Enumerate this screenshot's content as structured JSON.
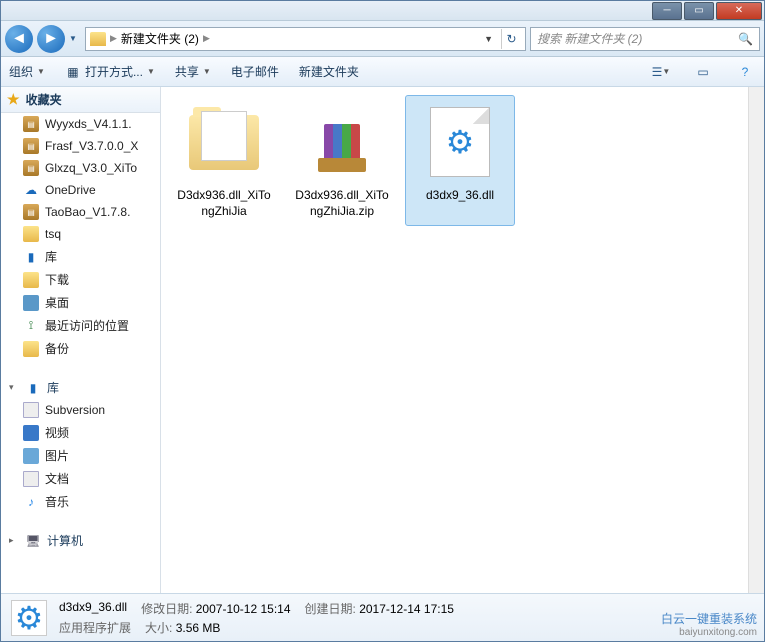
{
  "breadcrumb": {
    "current": "新建文件夹 (2)",
    "sep": "▶"
  },
  "search": {
    "placeholder": "搜索 新建文件夹 (2)"
  },
  "toolbar": {
    "organize": "组织",
    "open_with": "打开方式...",
    "share": "共享",
    "email": "电子邮件",
    "new_folder": "新建文件夹"
  },
  "sidebar": {
    "favorites": "收藏夹",
    "fav_items": [
      {
        "label": "Wyyxds_V4.1.1.",
        "icon": "rar"
      },
      {
        "label": "Frasf_V3.7.0.0_X",
        "icon": "rar"
      },
      {
        "label": "Glxzq_V3.0_XiTo",
        "icon": "rar"
      },
      {
        "label": "OneDrive",
        "icon": "cloud"
      },
      {
        "label": "TaoBao_V1.7.8.",
        "icon": "rar"
      },
      {
        "label": "tsq",
        "icon": "fold"
      },
      {
        "label": "库",
        "icon": "lib"
      },
      {
        "label": "下载",
        "icon": "fold"
      },
      {
        "label": "桌面",
        "icon": "desk"
      },
      {
        "label": "最近访问的位置",
        "icon": "loc"
      },
      {
        "label": "备份",
        "icon": "fold"
      }
    ],
    "library": "库",
    "lib_items": [
      {
        "label": "Subversion",
        "icon": "doc"
      },
      {
        "label": "视频",
        "icon": "vid"
      },
      {
        "label": "图片",
        "icon": "pic"
      },
      {
        "label": "文档",
        "icon": "doc"
      },
      {
        "label": "音乐",
        "icon": "mus"
      }
    ],
    "computer": "计算机"
  },
  "files": [
    {
      "label": "D3dx936.dll_XiTongZhiJia",
      "type": "folder"
    },
    {
      "label": "D3dx936.dll_XiTongZhiJia.zip",
      "type": "rar"
    },
    {
      "label": "d3dx9_36.dll",
      "type": "dll",
      "selected": true
    }
  ],
  "status": {
    "filename": "d3dx9_36.dll",
    "type": "应用程序扩展",
    "mod_label": "修改日期:",
    "mod_value": "2007-10-12 15:14",
    "create_label": "创建日期:",
    "create_value": "2017-12-14 17:15",
    "size_label": "大小:",
    "size_value": "3.56 MB"
  },
  "watermark": {
    "line1": "白云一键重装系统",
    "line2": "baiyunxitong.com"
  }
}
